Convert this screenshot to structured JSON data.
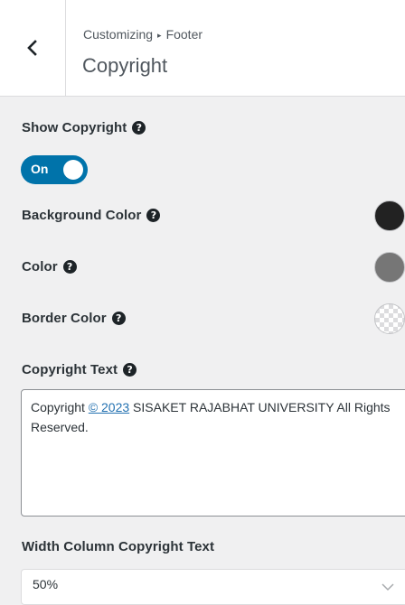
{
  "header": {
    "breadcrumb_root": "Customizing",
    "breadcrumb_separator": "▸",
    "breadcrumb_section": "Footer",
    "title": "Copyright"
  },
  "show_copyright": {
    "label": "Show Copyright",
    "toggle_text": "On",
    "enabled": true
  },
  "background_color": {
    "label": "Background Color",
    "value": "#222222"
  },
  "color": {
    "label": "Color",
    "value": "#767676"
  },
  "border_color": {
    "label": "Border Color",
    "value": "transparent"
  },
  "copyright_text": {
    "label": "Copyright Text",
    "prefix": "Copyright",
    "link_text": "©  2023",
    "suffix": " SISAKET RAJABHAT UNIVERSITY All Rights Reserved."
  },
  "width_column": {
    "label": "Width Column Copyright Text",
    "selected": "50%"
  },
  "icons": {
    "back": "chevron-left-icon",
    "help": "question-circle-icon",
    "select": "chevron-down-icon"
  },
  "colors": {
    "accent": "#0073aa",
    "link": "#2271b1"
  }
}
